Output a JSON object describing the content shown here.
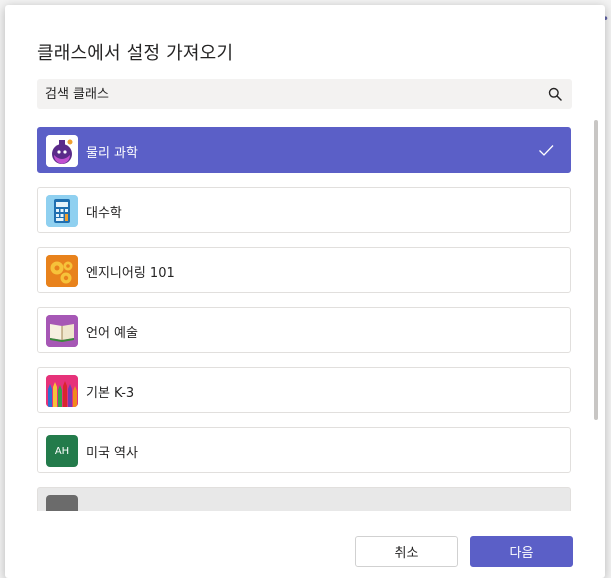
{
  "dialog": {
    "title": "클래스에서 설정 가져오기",
    "search": {
      "value": "",
      "placeholder": "검색 클래스"
    },
    "classes": [
      {
        "label": "물리 과학",
        "selected": true,
        "icon": "flask-icon"
      },
      {
        "label": "대수학",
        "selected": false,
        "icon": "calculator-icon"
      },
      {
        "label": "엔지니어링 101",
        "selected": false,
        "icon": "gears-icon"
      },
      {
        "label": "언어 예술",
        "selected": false,
        "icon": "book-icon"
      },
      {
        "label": "기본 K-3",
        "selected": false,
        "icon": "crayons-icon"
      },
      {
        "label": "미국 역사",
        "selected": false,
        "icon": "initials-icon",
        "initials": "AH"
      },
      {
        "label": "",
        "selected": false,
        "icon": "placeholder-icon"
      }
    ],
    "buttons": {
      "cancel": "취소",
      "next": "다음"
    }
  },
  "colors": {
    "accent": "#5b5fc7",
    "history_tile": "#237b4b",
    "selected_text": "#ffffff"
  }
}
